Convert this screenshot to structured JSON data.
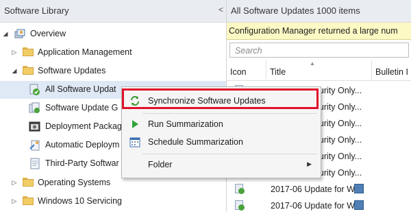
{
  "nav": {
    "title": "Software Library",
    "collapse_glyph": "<",
    "items": [
      {
        "label": "Overview",
        "icon": "overview-icon",
        "expanded": true
      },
      {
        "label": "Application Management",
        "icon": "folder-icon",
        "expanded": false
      },
      {
        "label": "Software Updates",
        "icon": "folder-icon",
        "expanded": true
      },
      {
        "label": "All Software Updat",
        "icon": "software-updates-icon",
        "selected": true
      },
      {
        "label": "Software Update G",
        "icon": "update-group-icon"
      },
      {
        "label": "Deployment Packag",
        "icon": "deployment-package-icon"
      },
      {
        "label": "Automatic Deploym",
        "icon": "automatic-deployment-icon"
      },
      {
        "label": "Third-Party Softwar",
        "icon": "third-party-icon"
      },
      {
        "label": "Operating Systems",
        "icon": "folder-icon",
        "expanded": false
      },
      {
        "label": "Windows 10 Servicing",
        "icon": "folder-icon",
        "expanded": false
      }
    ]
  },
  "pane": {
    "title": "All Software Updates 1000 items",
    "info": "Configuration Manager returned a large num",
    "search_placeholder": "Search",
    "columns": [
      "Icon",
      "Title",
      "Bulletin I"
    ],
    "rows": [
      "2017-05 Security Only...",
      "2017-06 Security Only...",
      "2017-06 Security Only...",
      "2017-06 Security Only...",
      "2017-06 Security Only...",
      "2017-06 Security Only...",
      "2017-06 Update for W...",
      "2017-06 Update for W..."
    ]
  },
  "context_menu": {
    "items": [
      {
        "label": "Synchronize Software Updates",
        "icon": "sync-icon",
        "highlighted": true
      },
      {
        "label": "Run Summarization",
        "icon": "run-icon"
      },
      {
        "label": "Schedule Summarization",
        "icon": "schedule-icon"
      },
      {
        "label": "Folder",
        "icon": "",
        "has_submenu": true
      }
    ]
  },
  "colors": {
    "highlight_border": "#e0112b",
    "info_bar": "#fdf9c4",
    "header_bg": "#e9ecf0"
  }
}
